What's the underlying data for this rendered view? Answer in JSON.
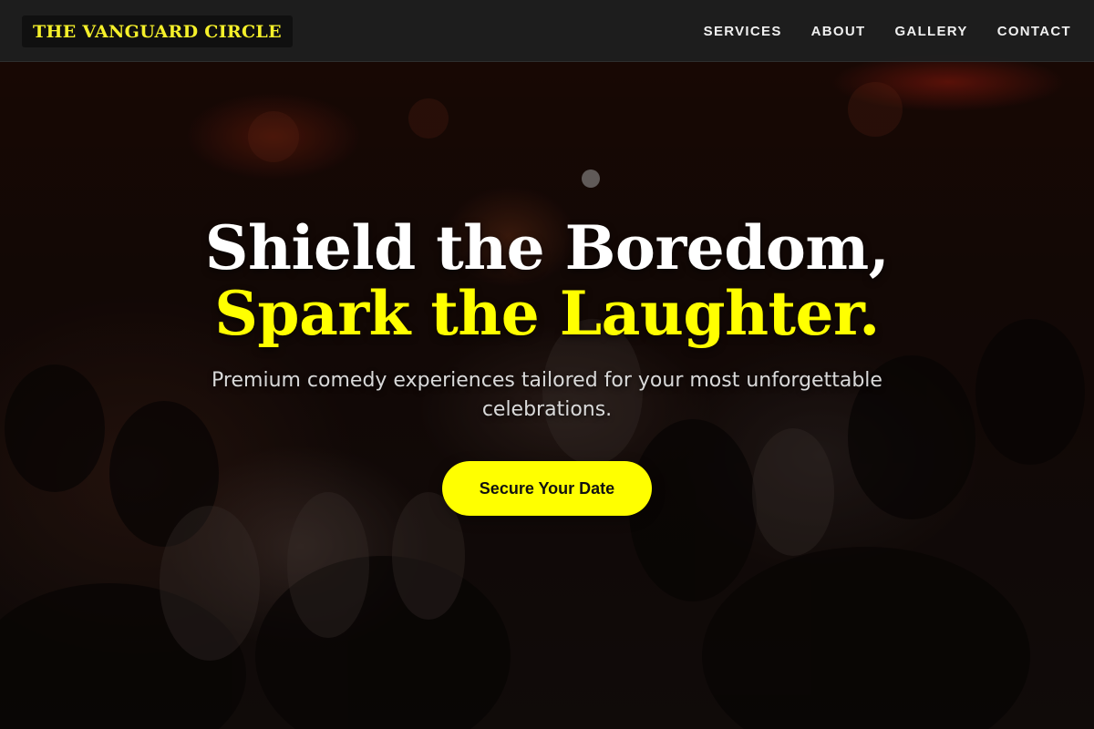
{
  "nav": {
    "brand": "THE VANGUARD CIRCLE",
    "links": [
      {
        "label": "SERVICES"
      },
      {
        "label": "ABOUT"
      },
      {
        "label": "GALLERY"
      },
      {
        "label": "CONTACT"
      }
    ]
  },
  "hero": {
    "headline_line1": "Shield the Boredom,",
    "headline_line2": "Spark the Laughter.",
    "subtitle": "Premium comedy experiences tailored for your most unforgettable celebrations.",
    "cta_label": "Secure Your Date"
  },
  "colors": {
    "accent": "#ffff00",
    "nav_background": "#1e1e1e",
    "text_light": "#ffffff"
  }
}
